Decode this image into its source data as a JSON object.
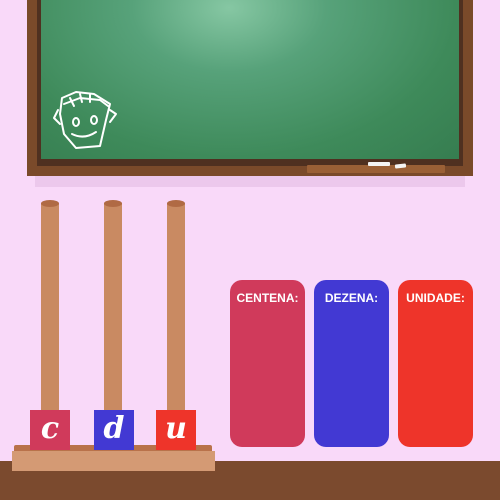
{
  "abacus": {
    "rods": [
      {
        "label": "c",
        "color": "#d03a5b"
      },
      {
        "label": "d",
        "color": "#4239d3"
      },
      {
        "label": "u",
        "color": "#ee342a"
      }
    ]
  },
  "panels": {
    "centena": {
      "label": "CENTENA:",
      "color": "#d03a5b"
    },
    "dezena": {
      "label": "DEZENA:",
      "color": "#4239d3"
    },
    "unidade": {
      "label": "UNIDADE:",
      "color": "#ee342a"
    }
  },
  "colors": {
    "background": "#f9d9f9",
    "chalkboard": "#3e8a5a",
    "board_frame": "#7a4a2a",
    "floor": "#7b4a2e"
  }
}
